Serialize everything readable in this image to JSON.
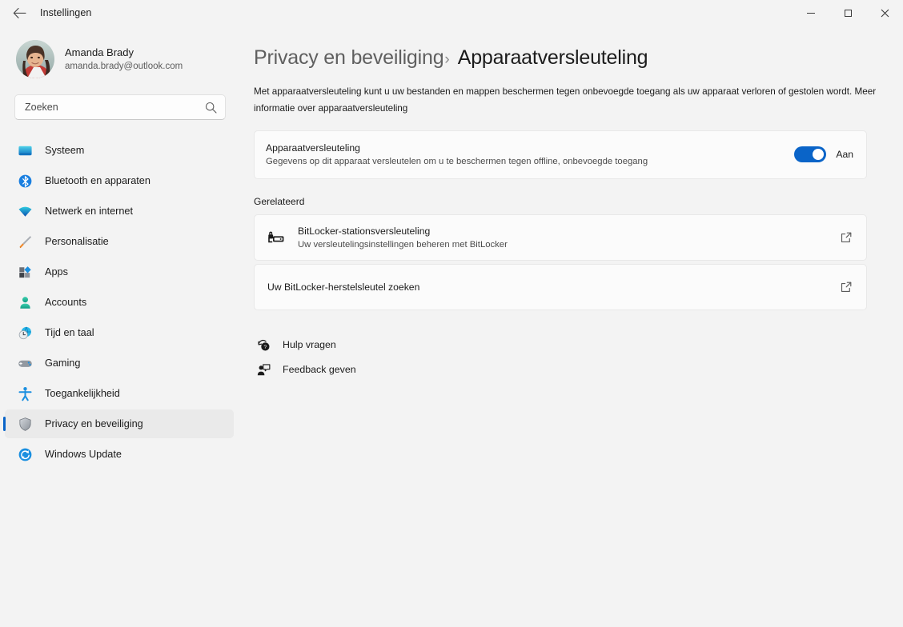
{
  "window": {
    "title": "Instellingen",
    "back_icon": "back-arrow-icon",
    "minimize_label": "–",
    "maximize_label": "□",
    "close_label": "✕"
  },
  "accent_color": "#0a64c8",
  "profile": {
    "name": "Amanda Brady",
    "email": "amanda.brady@outlook.com",
    "avatar_icon": "user-avatar-photo"
  },
  "search": {
    "placeholder": "Zoeken",
    "value": "",
    "icon": "search-icon"
  },
  "sidebar": {
    "items": [
      {
        "label": "Systeem",
        "icon": "monitor-icon",
        "selected": false
      },
      {
        "label": "Bluetooth en apparaten",
        "icon": "bluetooth-icon",
        "selected": false
      },
      {
        "label": "Netwerk en internet",
        "icon": "wifi-icon",
        "selected": false
      },
      {
        "label": "Personalisatie",
        "icon": "paintbrush-icon",
        "selected": false
      },
      {
        "label": "Apps",
        "icon": "apps-icon",
        "selected": false
      },
      {
        "label": "Accounts",
        "icon": "person-icon",
        "selected": false
      },
      {
        "label": "Tijd en taal",
        "icon": "clock-globe-icon",
        "selected": false
      },
      {
        "label": "Gaming",
        "icon": "gamepad-icon",
        "selected": false
      },
      {
        "label": "Toegankelijkheid",
        "icon": "accessibility-icon",
        "selected": false
      },
      {
        "label": "Privacy en beveiliging",
        "icon": "shield-icon",
        "selected": true
      },
      {
        "label": "Windows Update",
        "icon": "refresh-icon",
        "selected": false
      }
    ]
  },
  "main": {
    "breadcrumb": {
      "parent": "Privacy en beveiliging",
      "separator": "›",
      "current": "Apparaatversleuteling"
    },
    "description": "Met apparaatversleuteling kunt u uw bestanden en mappen beschermen tegen onbevoegde toegang als uw apparaat verloren of gestolen wordt. Meer informatie over apparaatversleuteling",
    "encryption_setting": {
      "title": "Apparaatversleuteling",
      "subtitle": "Gegevens op dit apparaat versleutelen om u te beschermen tegen offline, onbevoegde toegang",
      "toggle_state": "Aan"
    },
    "related_heading": "Gerelateerd",
    "related_items": [
      {
        "title": "BitLocker-stationsversleuteling",
        "subtitle": "Uw versleutelingsinstellingen beheren met BitLocker",
        "icon": "bitlocker-drive-icon",
        "action_icon": "open-external-icon"
      },
      {
        "title": "Uw BitLocker-herstelsleutel zoeken",
        "subtitle": "",
        "icon": "",
        "action_icon": "open-external-icon"
      }
    ],
    "help_links": [
      {
        "label": "Hulp vragen",
        "icon": "help-question-icon"
      },
      {
        "label": "Feedback geven",
        "icon": "feedback-person-icon"
      }
    ]
  }
}
